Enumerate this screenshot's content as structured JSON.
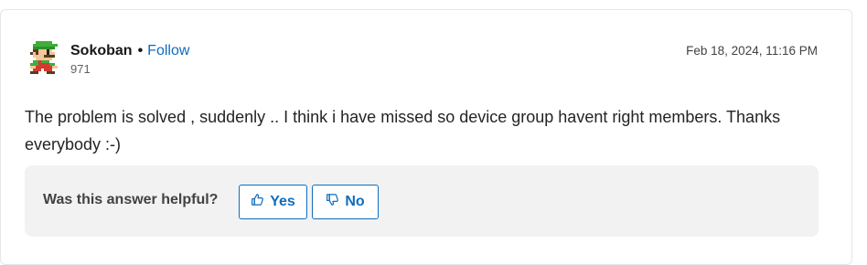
{
  "post": {
    "author": "Sokoban",
    "separator": "•",
    "follow_label": "Follow",
    "reputation": "971",
    "timestamp": "Feb 18, 2024, 11:16 PM",
    "body": "The problem is solved , suddenly .. I think i have missed so device group havent right members. Thanks everybody :-)"
  },
  "feedback": {
    "question": "Was this answer helpful?",
    "yes_label": "Yes",
    "no_label": "No"
  },
  "colors": {
    "link": "#0f6cbd",
    "panel_background": "#f2f2f2"
  }
}
